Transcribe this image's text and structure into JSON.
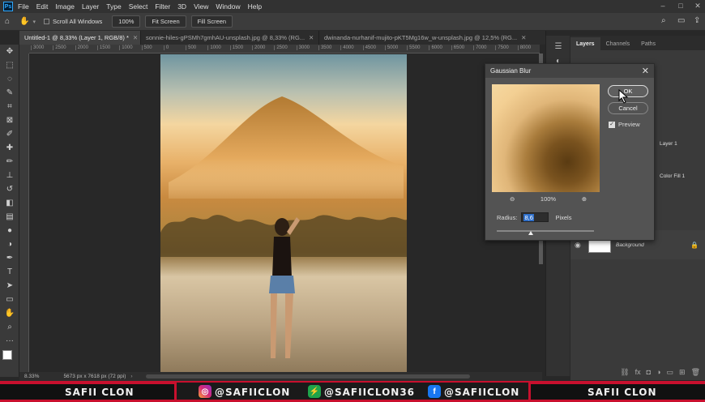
{
  "menubar": {
    "logo": "Ps",
    "items": [
      "File",
      "Edit",
      "Image",
      "Layer",
      "Type",
      "Select",
      "Filter",
      "3D",
      "View",
      "Window",
      "Help"
    ]
  },
  "options": {
    "scroll_all_windows": "Scroll All Windows",
    "zoom_value": "100%",
    "fit_screen": "Fit Screen",
    "fill_screen": "Fill Screen"
  },
  "tabs": [
    {
      "label": "Untitled-1 @ 8,33% (Layer 1, RGB/8) *",
      "active": true
    },
    {
      "label": "sonnie-hiles-gPSMh7gmhAU-unsplash.jpg @ 8,33% (RG...",
      "active": false
    },
    {
      "label": "dwinanda-nurhanif-mujito-pKT5Mg16w_w-unsplash.jpg @ 12,5% (RG...",
      "active": false
    }
  ],
  "ruler": {
    "marks": [
      "3000",
      "2500",
      "2000",
      "1500",
      "1000",
      "500",
      "0",
      "500",
      "1000",
      "1500",
      "2000",
      "2500",
      "3000",
      "3500",
      "4000",
      "4500",
      "5000",
      "5500",
      "6000",
      "6500",
      "7000",
      "7500",
      "8000"
    ]
  },
  "status": {
    "zoom": "8.33%",
    "doc_info": "5673 px x 7618 px (72 ppi)"
  },
  "layers_panel": {
    "tabs": [
      "Layers",
      "Channels",
      "Paths"
    ],
    "layers": [
      {
        "name": "Layer 1"
      },
      {
        "name": "Color Fill 1"
      },
      {
        "name": "Background"
      }
    ]
  },
  "dialog": {
    "title": "Gaussian Blur",
    "ok": "OK",
    "cancel": "Cancel",
    "preview_label": "Preview",
    "preview_checked": true,
    "zoom": "100%",
    "radius_label": "Radius:",
    "radius_value": "8,6",
    "radius_unit": "Pixels"
  },
  "banner": {
    "left": "SAFII CLON",
    "instagram": "@SAFIICLON",
    "other": "@SAFIICLON36",
    "facebook": "@SAFIICLON",
    "right": "SAFII CLON"
  }
}
